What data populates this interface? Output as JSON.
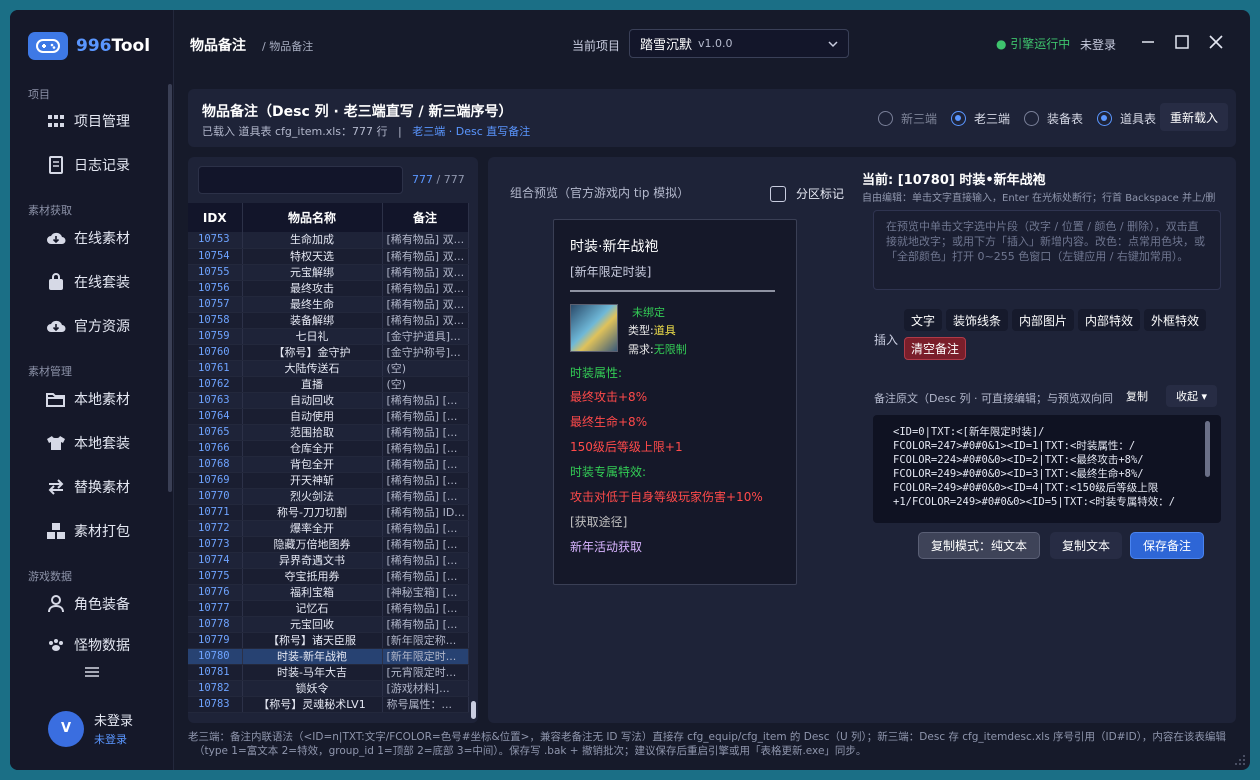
{
  "app": {
    "logo_prefix": "996",
    "logo_suffix": "Tool"
  },
  "sidebar": {
    "sections": [
      {
        "label": "项目",
        "items": [
          "项目管理",
          "日志记录"
        ]
      },
      {
        "label": "素材获取",
        "items": [
          "在线素材",
          "在线套装",
          "官方资源"
        ]
      },
      {
        "label": "素材管理",
        "items": [
          "本地素材",
          "本地套装",
          "替换素材",
          "素材打包"
        ]
      },
      {
        "label": "游戏数据",
        "items": [
          "角色装备",
          "怪物数据"
        ]
      }
    ],
    "user": {
      "initial": "V",
      "name": "未登录",
      "status": "未登录"
    }
  },
  "header": {
    "title": "物品备注",
    "breadcrumb": "/ 物品备注",
    "project_label": "当前项目",
    "project_name": "踏雪沉默",
    "project_version": "v1.0.0",
    "engine_status": "● 引擎运行中",
    "login": "未登录"
  },
  "top_card": {
    "title": "物品备注（Desc 列 · 老三端直写 / 新三端序号）",
    "subtitle": "已载入 道具表 cfg_item.xls：777 行",
    "separator": "|",
    "subtitle_link": "老三端 · Desc 直写备注",
    "radios": [
      {
        "label": "新三端",
        "checked": false,
        "dim": true
      },
      {
        "label": "老三端",
        "checked": true,
        "dim": false
      },
      {
        "label": "装备表",
        "checked": false,
        "dim": false
      },
      {
        "label": "道具表",
        "checked": true,
        "dim": false
      }
    ],
    "reload": "重新载入"
  },
  "list": {
    "search_value": "",
    "count_shown": "777",
    "count_total": "/ 777",
    "columns": [
      "IDX",
      "物品名称",
      "备注"
    ],
    "selected_id": "10780",
    "rows": [
      [
        "10753",
        "生命加成",
        "[稀有物品] 双..."
      ],
      [
        "10754",
        "特权天选",
        "[稀有物品] 双..."
      ],
      [
        "10755",
        "元宝解绑",
        "[稀有物品] 双..."
      ],
      [
        "10756",
        "最终攻击",
        "[稀有物品] 双..."
      ],
      [
        "10757",
        "最终生命",
        "[稀有物品] 双..."
      ],
      [
        "10758",
        "装备解绑",
        "[稀有物品] 双..."
      ],
      [
        "10759",
        "七日礼",
        "[金守护道具]..."
      ],
      [
        "10760",
        "【称号】金守护",
        "[金守护称号]..."
      ],
      [
        "10761",
        "大陆传送石",
        "(空)"
      ],
      [
        "10762",
        "直播",
        "(空)"
      ],
      [
        "10763",
        "自动回收",
        "[稀有物品] [..."
      ],
      [
        "10764",
        "自动使用",
        "[稀有物品] [..."
      ],
      [
        "10765",
        "范围拾取",
        "[稀有物品] [..."
      ],
      [
        "10766",
        "仓库全开",
        "[稀有物品] [..."
      ],
      [
        "10768",
        "背包全开",
        "[稀有物品] [..."
      ],
      [
        "10769",
        "开天神斩",
        "[稀有物品] [..."
      ],
      [
        "10770",
        "烈火剑法",
        "[稀有物品] [..."
      ],
      [
        "10771",
        "称号-刀刀切割",
        "[稀有物品] ID..."
      ],
      [
        "10772",
        "爆率全开",
        "[稀有物品] [..."
      ],
      [
        "10773",
        "隐藏万倍地图券",
        "[稀有物品] [..."
      ],
      [
        "10774",
        "异界奇遇文书",
        "[稀有物品] [..."
      ],
      [
        "10775",
        "夺宝抵用券",
        "[稀有物品] [..."
      ],
      [
        "10776",
        "福利宝箱",
        "[神秘宝箱] [..."
      ],
      [
        "10777",
        "记忆石",
        "[稀有物品] [..."
      ],
      [
        "10778",
        "元宝回收",
        "[稀有物品] [..."
      ],
      [
        "10779",
        "【称号】诸天臣服",
        "[新年限定称..."
      ],
      [
        "10780",
        "时装-新年战袍",
        "[新年限定时..."
      ],
      [
        "10781",
        "时装-马年大吉",
        "[元宵限定时..."
      ],
      [
        "10782",
        "锁妖令",
        "[游戏材料]..."
      ],
      [
        "10783",
        "【称号】灵魂秘术LV1",
        "称号属性：..."
      ]
    ]
  },
  "preview": {
    "label": "组合预览（官方游戏内 tip 模拟）",
    "split_label": "分区标记",
    "tip": {
      "name": "时装·新年战袍",
      "tag": "[新年限定时装]",
      "bind": "未绑定",
      "type_label": "类型:",
      "type_value": "道具",
      "req_label": "需求:",
      "req_value": "无限制",
      "attr_title": "时装属性:",
      "attrs": [
        "最终攻击+8%",
        "最终生命+8%",
        "150级后等级上限+1"
      ],
      "special_title": "时装专属特效:",
      "special": "攻击对低于自身等级玩家伤害+10%",
      "source_title": "[获取途径]",
      "source": "新年活动获取"
    }
  },
  "editor": {
    "current": "当前: [10780] 时装•新年战袍",
    "hint": "自由编辑：单击文字直接输入，Enter 在光标处断行；行首 Backspace 并上/删",
    "placeholder": "在预览中单击文字选中片段（改字 / 位置 / 颜色 / 删除），双击直接就地改字；或用下方「插入」新增内容。改色：点常用色块，或「全部颜色」打开 0~255 色窗口（左键应用 / 右键加常用）。",
    "insert_label": "插入",
    "insert_buttons": [
      "文字",
      "装饰线条",
      "内部图片",
      "内部特效",
      "外框特效"
    ],
    "clear": "清空备注",
    "raw_label": "备注原文（Desc 列 · 可直接编辑；与预览双向同",
    "copy": "复制",
    "collapse": "收起 ▾",
    "raw_lines": [
      "<ID=0|TXT:<[新年限定时装]/",
      "FCOLOR=247>#0#0&1><ID=1|TXT:<时装属性：/",
      "FCOLOR=224>#0#0&0><ID=2|TXT:<最终攻击+8%/",
      "FCOLOR=249>#0#0&0><ID=3|TXT:<最终生命+8%/",
      "FCOLOR=249>#0#0&0><ID=4|TXT:<150级后等级上限",
      "+1/FCOLOR=249>#0#0&0><ID=5|TXT:<时装专属特效：/"
    ],
    "copy_mode": "复制模式：纯文本",
    "copy_text": "复制文本",
    "save": "保存备注"
  },
  "footer": {
    "line1": "老三端：备注内联语法（<ID=n|TXT:文字/FCOLOR=色号#坐标&位置>，兼容老备注无 ID 写法）直接存 cfg_equip/cfg_item 的 Desc（U 列）；新三端：Desc 存 cfg_itemdesc.xls 序号引用（ID#ID），内容在该表编辑",
    "line2": "（type 1=富文本 2=特效，group_id 1=顶部 2=底部 3=中间）。保存写 .bak + 撤销批次；建议保存后重启引擎或用「表格更新.exe」同步。"
  }
}
